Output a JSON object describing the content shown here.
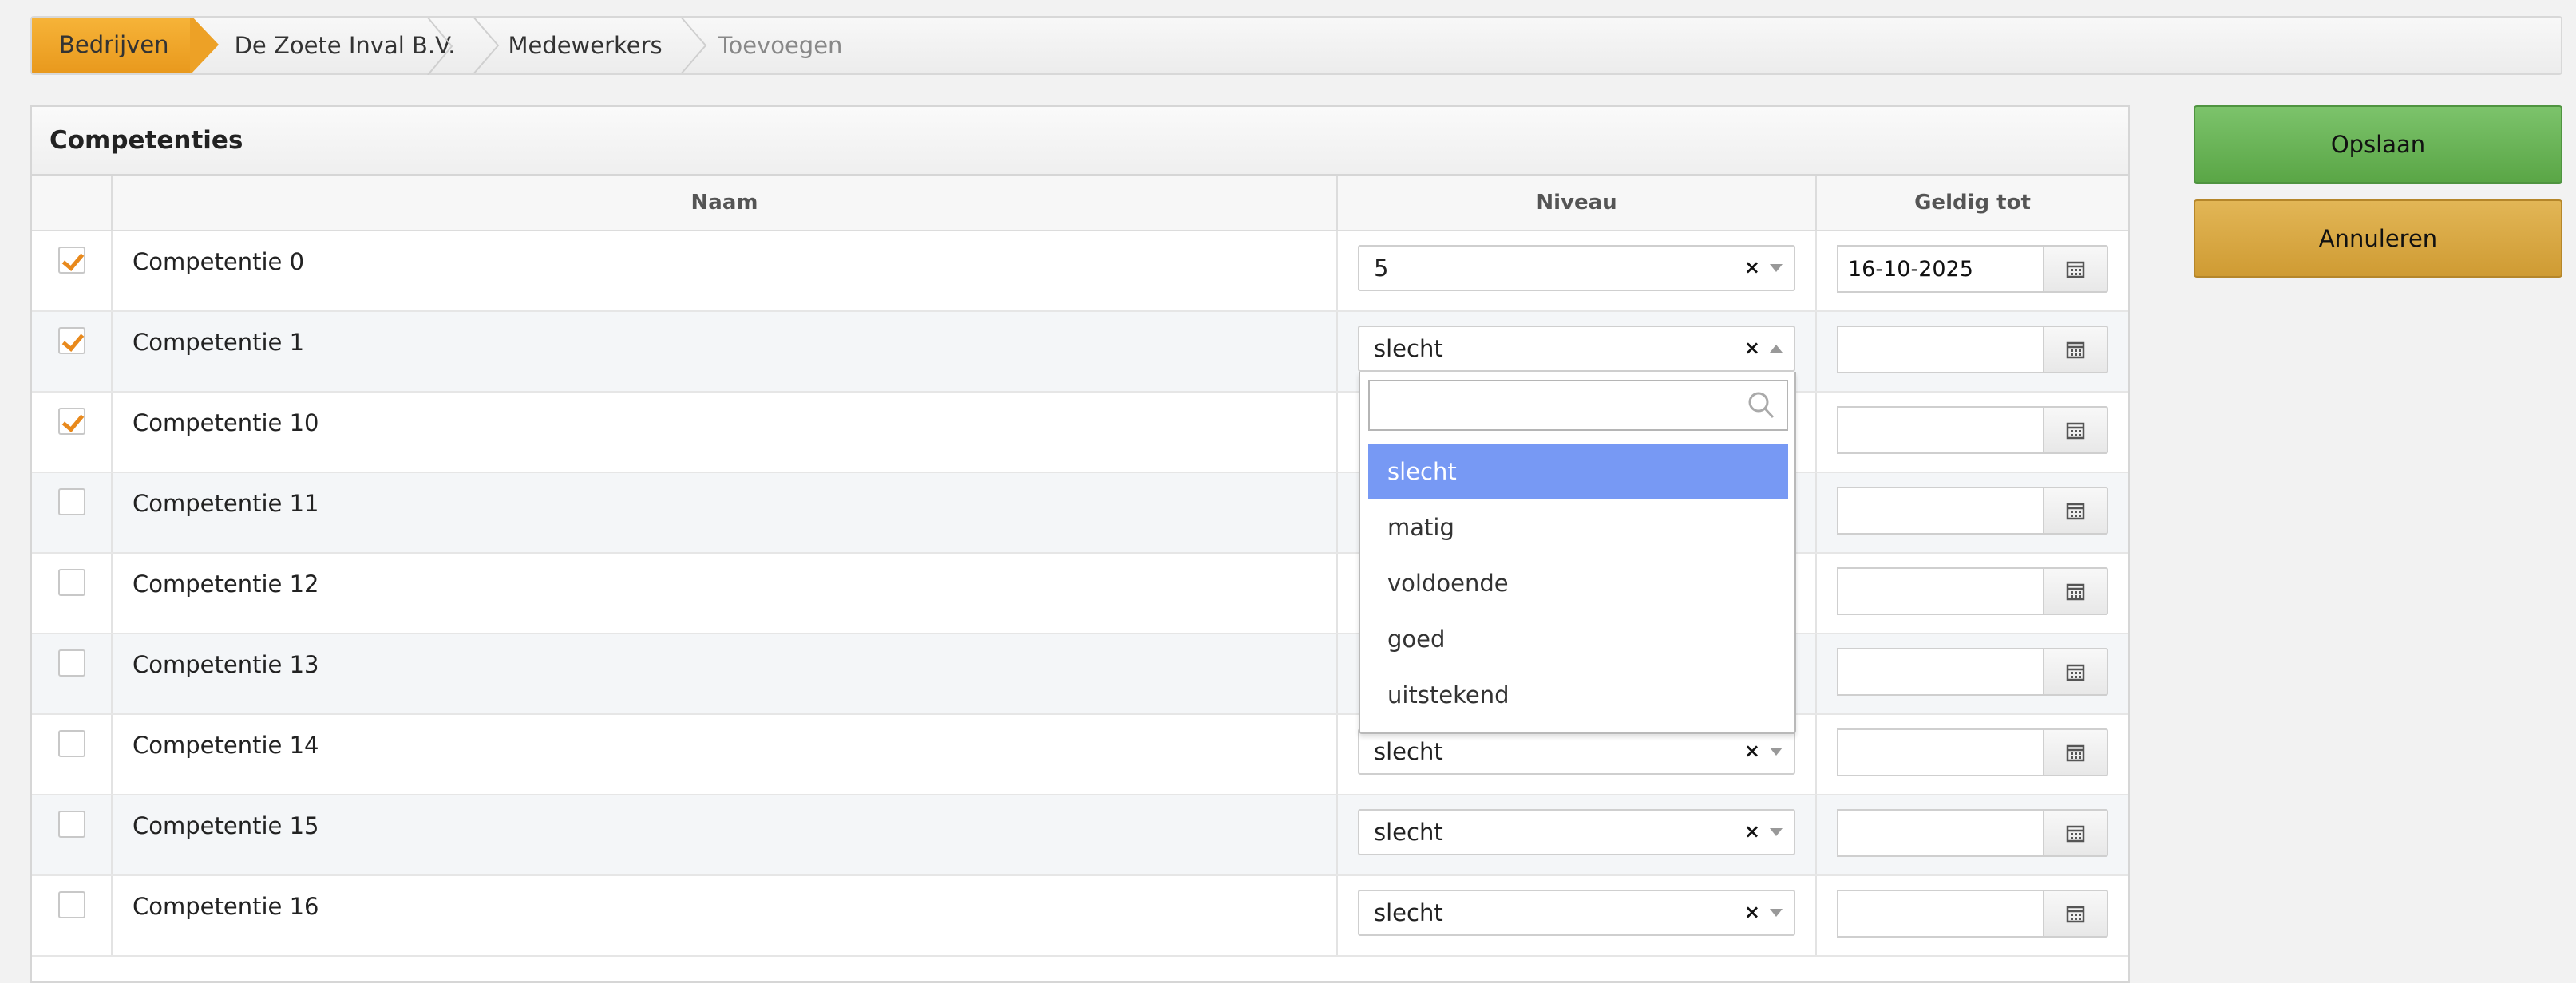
{
  "breadcrumb": {
    "items": [
      "Bedrijven",
      "De Zoete Inval B.V.",
      "Medewerkers",
      "Toevoegen"
    ]
  },
  "panel": {
    "title": "Competenties",
    "columns": {
      "naam": "Naam",
      "niveau": "Niveau",
      "geldig": "Geldig tot"
    },
    "rows": [
      {
        "checked": true,
        "name": "Competentie 0",
        "level": "5",
        "date": "16-10-2025"
      },
      {
        "checked": true,
        "name": "Competentie 1",
        "level": "slecht",
        "date": ""
      },
      {
        "checked": true,
        "name": "Competentie 10",
        "level": "",
        "date": ""
      },
      {
        "checked": false,
        "name": "Competentie 11",
        "level": "",
        "date": ""
      },
      {
        "checked": false,
        "name": "Competentie 12",
        "level": "",
        "date": ""
      },
      {
        "checked": false,
        "name": "Competentie 13",
        "level": "",
        "date": ""
      },
      {
        "checked": false,
        "name": "Competentie 14",
        "level": "slecht",
        "date": ""
      },
      {
        "checked": false,
        "name": "Competentie 15",
        "level": "slecht",
        "date": ""
      },
      {
        "checked": false,
        "name": "Competentie 16",
        "level": "slecht",
        "date": ""
      }
    ]
  },
  "dropdown": {
    "search_value": "",
    "options": [
      "slecht",
      "matig",
      "voldoende",
      "goed",
      "uitstekend"
    ],
    "highlighted": "slecht"
  },
  "buttons": {
    "save": "Opslaan",
    "cancel": "Annuleren"
  },
  "icons": {
    "clear": "×",
    "calendar": "calendar-icon",
    "search": "search-icon"
  },
  "colors": {
    "accent": "#eda126",
    "save": "#6ab556",
    "cancel": "#d9a843",
    "highlight": "#7799f4",
    "check": "#e8891c"
  }
}
